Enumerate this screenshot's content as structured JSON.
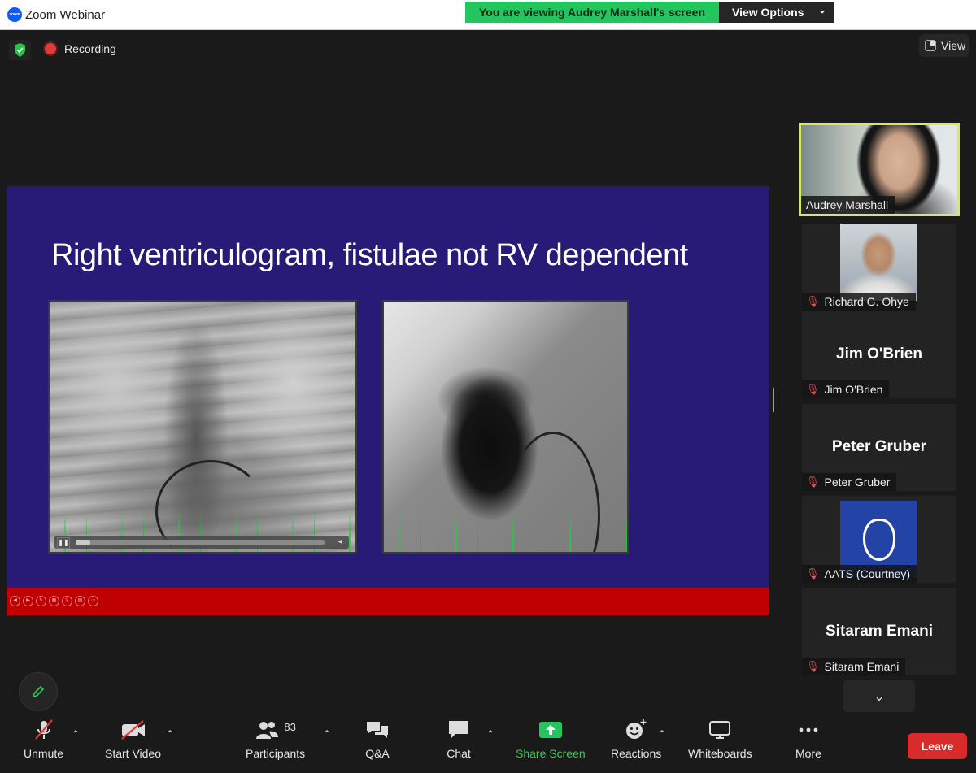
{
  "window": {
    "title": "Zoom Webinar",
    "logo_text": "zoom"
  },
  "share_banner": {
    "text": "You are viewing Audrey Marshall's screen",
    "view_options": "View Options"
  },
  "status": {
    "recording": "Recording",
    "view": "View"
  },
  "slide": {
    "title": "Right ventriculogram, fistulae not RV dependent",
    "video_progress": 0.06
  },
  "participants": [
    {
      "name": "Audrey Marshall",
      "video": true,
      "active": true
    },
    {
      "name": "Richard G. Ohye",
      "video": true,
      "muted": true
    },
    {
      "name": "Jim O'Brien",
      "display": "Jim O'Brien",
      "muted": true
    },
    {
      "name": "Peter Gruber",
      "display": "Peter Gruber",
      "muted": true
    },
    {
      "name": "AATS (Courtney)",
      "muted": true
    },
    {
      "name": "Sitaram Emani",
      "display": "Sitaram Emani",
      "muted": true
    }
  ],
  "toolbar": {
    "unmute": "Unmute",
    "start_video": "Start Video",
    "participants": "Participants",
    "participant_count": "83",
    "qa": "Q&A",
    "chat": "Chat",
    "share_screen": "Share Screen",
    "reactions": "Reactions",
    "whiteboards": "Whiteboards",
    "more": "More",
    "leave": "Leave"
  },
  "colors": {
    "active_speaker": "#d6e86a",
    "share_green": "#22c55e",
    "leave_red": "#d92b2b",
    "slide_bg": "#281a77",
    "slide_footer": "#c00000"
  }
}
